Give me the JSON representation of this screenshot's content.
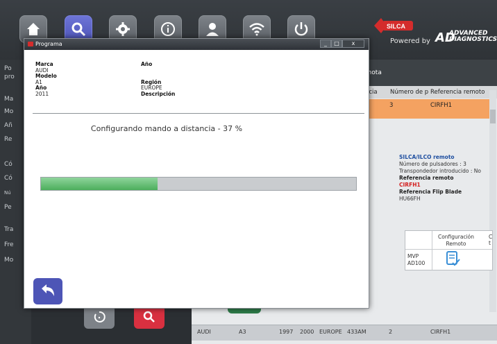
{
  "toolbar": {
    "buttons": [
      {
        "icon": "home-icon"
      },
      {
        "icon": "search-icon"
      },
      {
        "icon": "gear-icon"
      },
      {
        "icon": "info-icon"
      },
      {
        "icon": "user-icon"
      },
      {
        "icon": "wifi-icon"
      },
      {
        "icon": "power-icon"
      }
    ],
    "active_button": "search-icon",
    "accent_color": "#5a61c6"
  },
  "brand": {
    "logo_text": "SILCA",
    "powered_by": "Powered by",
    "advanced_line1": "ADVANCED",
    "advanced_line2": "DIAGNOSTICS"
  },
  "sidebar": {
    "items": [
      "Po",
      "pro",
      "Ma",
      "Mo",
      "Añ",
      "Re",
      "Có",
      "Có",
      "Nú",
      "Pe",
      "Tra",
      "Fre",
      "Mo"
    ]
  },
  "background_panel": {
    "header_text": "emota",
    "columns": [
      "ncia",
      "Número de p",
      "Referencia remoto"
    ],
    "selected_row": [
      "3",
      "CIRFH1"
    ],
    "details": {
      "type": "SILCA/ILCO remoto",
      "buttons": "Número de pulsadores : 3",
      "transponder": "Transpondedor introducido : No",
      "remote_ref_label": "Referencia remoto",
      "remote_ref_value": "CIRFH1",
      "blade_label": "Referencia Flip Blade",
      "blade_value": "HU66FH"
    },
    "config_table": {
      "header": "Configuración Remoto",
      "cut_header": "C t",
      "model_line1": "MVP",
      "model_line2": "AD100"
    },
    "bottom_row": [
      "AUDI",
      "A3",
      "1997",
      "2000",
      "EUROPE",
      "433AM",
      "2",
      "CIRFH1"
    ]
  },
  "dialog": {
    "title": "Programa",
    "window_controls": [
      "_",
      "□",
      "x"
    ],
    "fields": {
      "marca_label": "Marca",
      "marca_value": "AUDI",
      "modelo_label": "Modelo",
      "modelo_value": "A1",
      "ano_label": "Año",
      "ano_value": "2011",
      "ano2_label": "Año",
      "ano2_value": "",
      "region_label": "Región",
      "region_value": "EUROPE",
      "descripcion_label": "Descripción",
      "descripcion_value": ""
    },
    "status": "Configurando mando a distancia - 37 %",
    "progress": 0.37,
    "back_icon": "back-arrow-icon"
  }
}
